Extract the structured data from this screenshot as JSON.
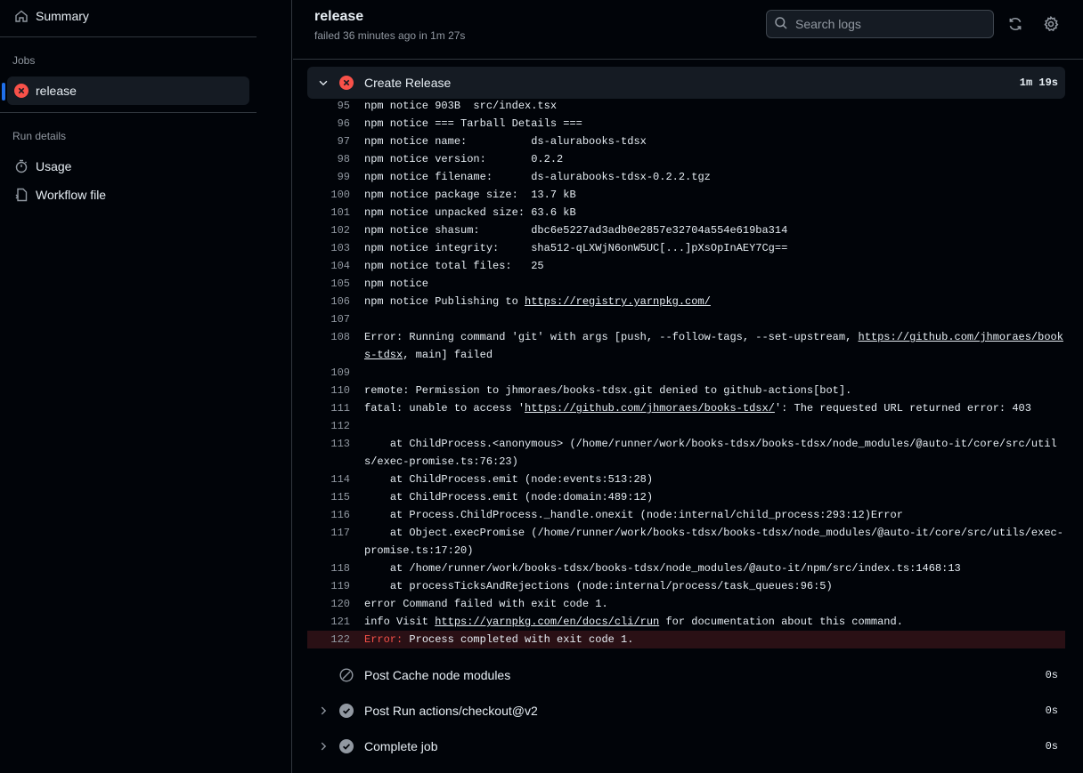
{
  "sidebar": {
    "summary_label": "Summary",
    "jobs_heading": "Jobs",
    "job_label": "release",
    "run_details_heading": "Run details",
    "usage_label": "Usage",
    "workflow_label": "Workflow file"
  },
  "header": {
    "title": "release",
    "subtitle": "failed 36 minutes ago in 1m 27s",
    "search_placeholder": "Search logs"
  },
  "step": {
    "name": "Create Release",
    "duration": "1m 19s"
  },
  "log_lines": [
    {
      "n": "95",
      "t": "npm notice 903B  src/index.tsx"
    },
    {
      "n": "96",
      "t": "npm notice === Tarball Details ==="
    },
    {
      "n": "97",
      "t": "npm notice name:          ds-alurabooks-tdsx"
    },
    {
      "n": "98",
      "t": "npm notice version:       0.2.2"
    },
    {
      "n": "99",
      "t": "npm notice filename:      ds-alurabooks-tdsx-0.2.2.tgz"
    },
    {
      "n": "100",
      "t": "npm notice package size:  13.7 kB"
    },
    {
      "n": "101",
      "t": "npm notice unpacked size: 63.6 kB"
    },
    {
      "n": "102",
      "t": "npm notice shasum:        dbc6e5227ad3adb0e2857e32704a554e619ba314"
    },
    {
      "n": "103",
      "t": "npm notice integrity:     sha512-qLXWjN6onW5UC[...]pXsOpInAEY7Cg=="
    },
    {
      "n": "104",
      "t": "npm notice total files:   25"
    },
    {
      "n": "105",
      "t": "npm notice"
    },
    {
      "n": "106",
      "t": "npm notice Publishing to ",
      "link": "https://registry.yarnpkg.com/",
      "after": ""
    },
    {
      "n": "107",
      "t": ""
    },
    {
      "n": "108",
      "t": "Error: Running command 'git' with args [push, --follow-tags, --set-upstream, ",
      "link": "https://github.com/jhmoraes/books-tdsx",
      "after": ", main] failed"
    },
    {
      "n": "109",
      "t": ""
    },
    {
      "n": "110",
      "t": "remote: Permission to jhmoraes/books-tdsx.git denied to github-actions[bot]."
    },
    {
      "n": "111",
      "t": "fatal: unable to access '",
      "link": "https://github.com/jhmoraes/books-tdsx/",
      "after": "': The requested URL returned error: 403"
    },
    {
      "n": "112",
      "t": ""
    },
    {
      "n": "113",
      "t": "    at ChildProcess.<anonymous> (/home/runner/work/books-tdsx/books-tdsx/node_modules/@auto-it/core/src/utils/exec-promise.ts:76:23)"
    },
    {
      "n": "114",
      "t": "    at ChildProcess.emit (node:events:513:28)"
    },
    {
      "n": "115",
      "t": "    at ChildProcess.emit (node:domain:489:12)"
    },
    {
      "n": "116",
      "t": "    at Process.ChildProcess._handle.onexit (node:internal/child_process:293:12)Error"
    },
    {
      "n": "117",
      "t": "    at Object.execPromise (/home/runner/work/books-tdsx/books-tdsx/node_modules/@auto-it/core/src/utils/exec-promise.ts:17:20)"
    },
    {
      "n": "118",
      "t": "    at /home/runner/work/books-tdsx/books-tdsx/node_modules/@auto-it/npm/src/index.ts:1468:13"
    },
    {
      "n": "119",
      "t": "    at processTicksAndRejections (node:internal/process/task_queues:96:5)"
    },
    {
      "n": "120",
      "t": "error Command failed with exit code 1."
    },
    {
      "n": "121",
      "t": "info Visit ",
      "link": "https://yarnpkg.com/en/docs/cli/run",
      "after": " for documentation about this command."
    },
    {
      "n": "122",
      "t": " Process completed with exit code 1.",
      "prefix": "Error:",
      "error": true
    }
  ],
  "other_steps": [
    {
      "name": "Post Cache node modules",
      "duration": "0s",
      "status": "skipped",
      "expandable": false
    },
    {
      "name": "Post Run actions/checkout@v2",
      "duration": "0s",
      "status": "success",
      "expandable": true
    },
    {
      "name": "Complete job",
      "duration": "0s",
      "status": "success",
      "expandable": true
    }
  ],
  "colors": {
    "error": "#f85149",
    "accent": "#1f6feb",
    "muted": "#9198a1"
  }
}
